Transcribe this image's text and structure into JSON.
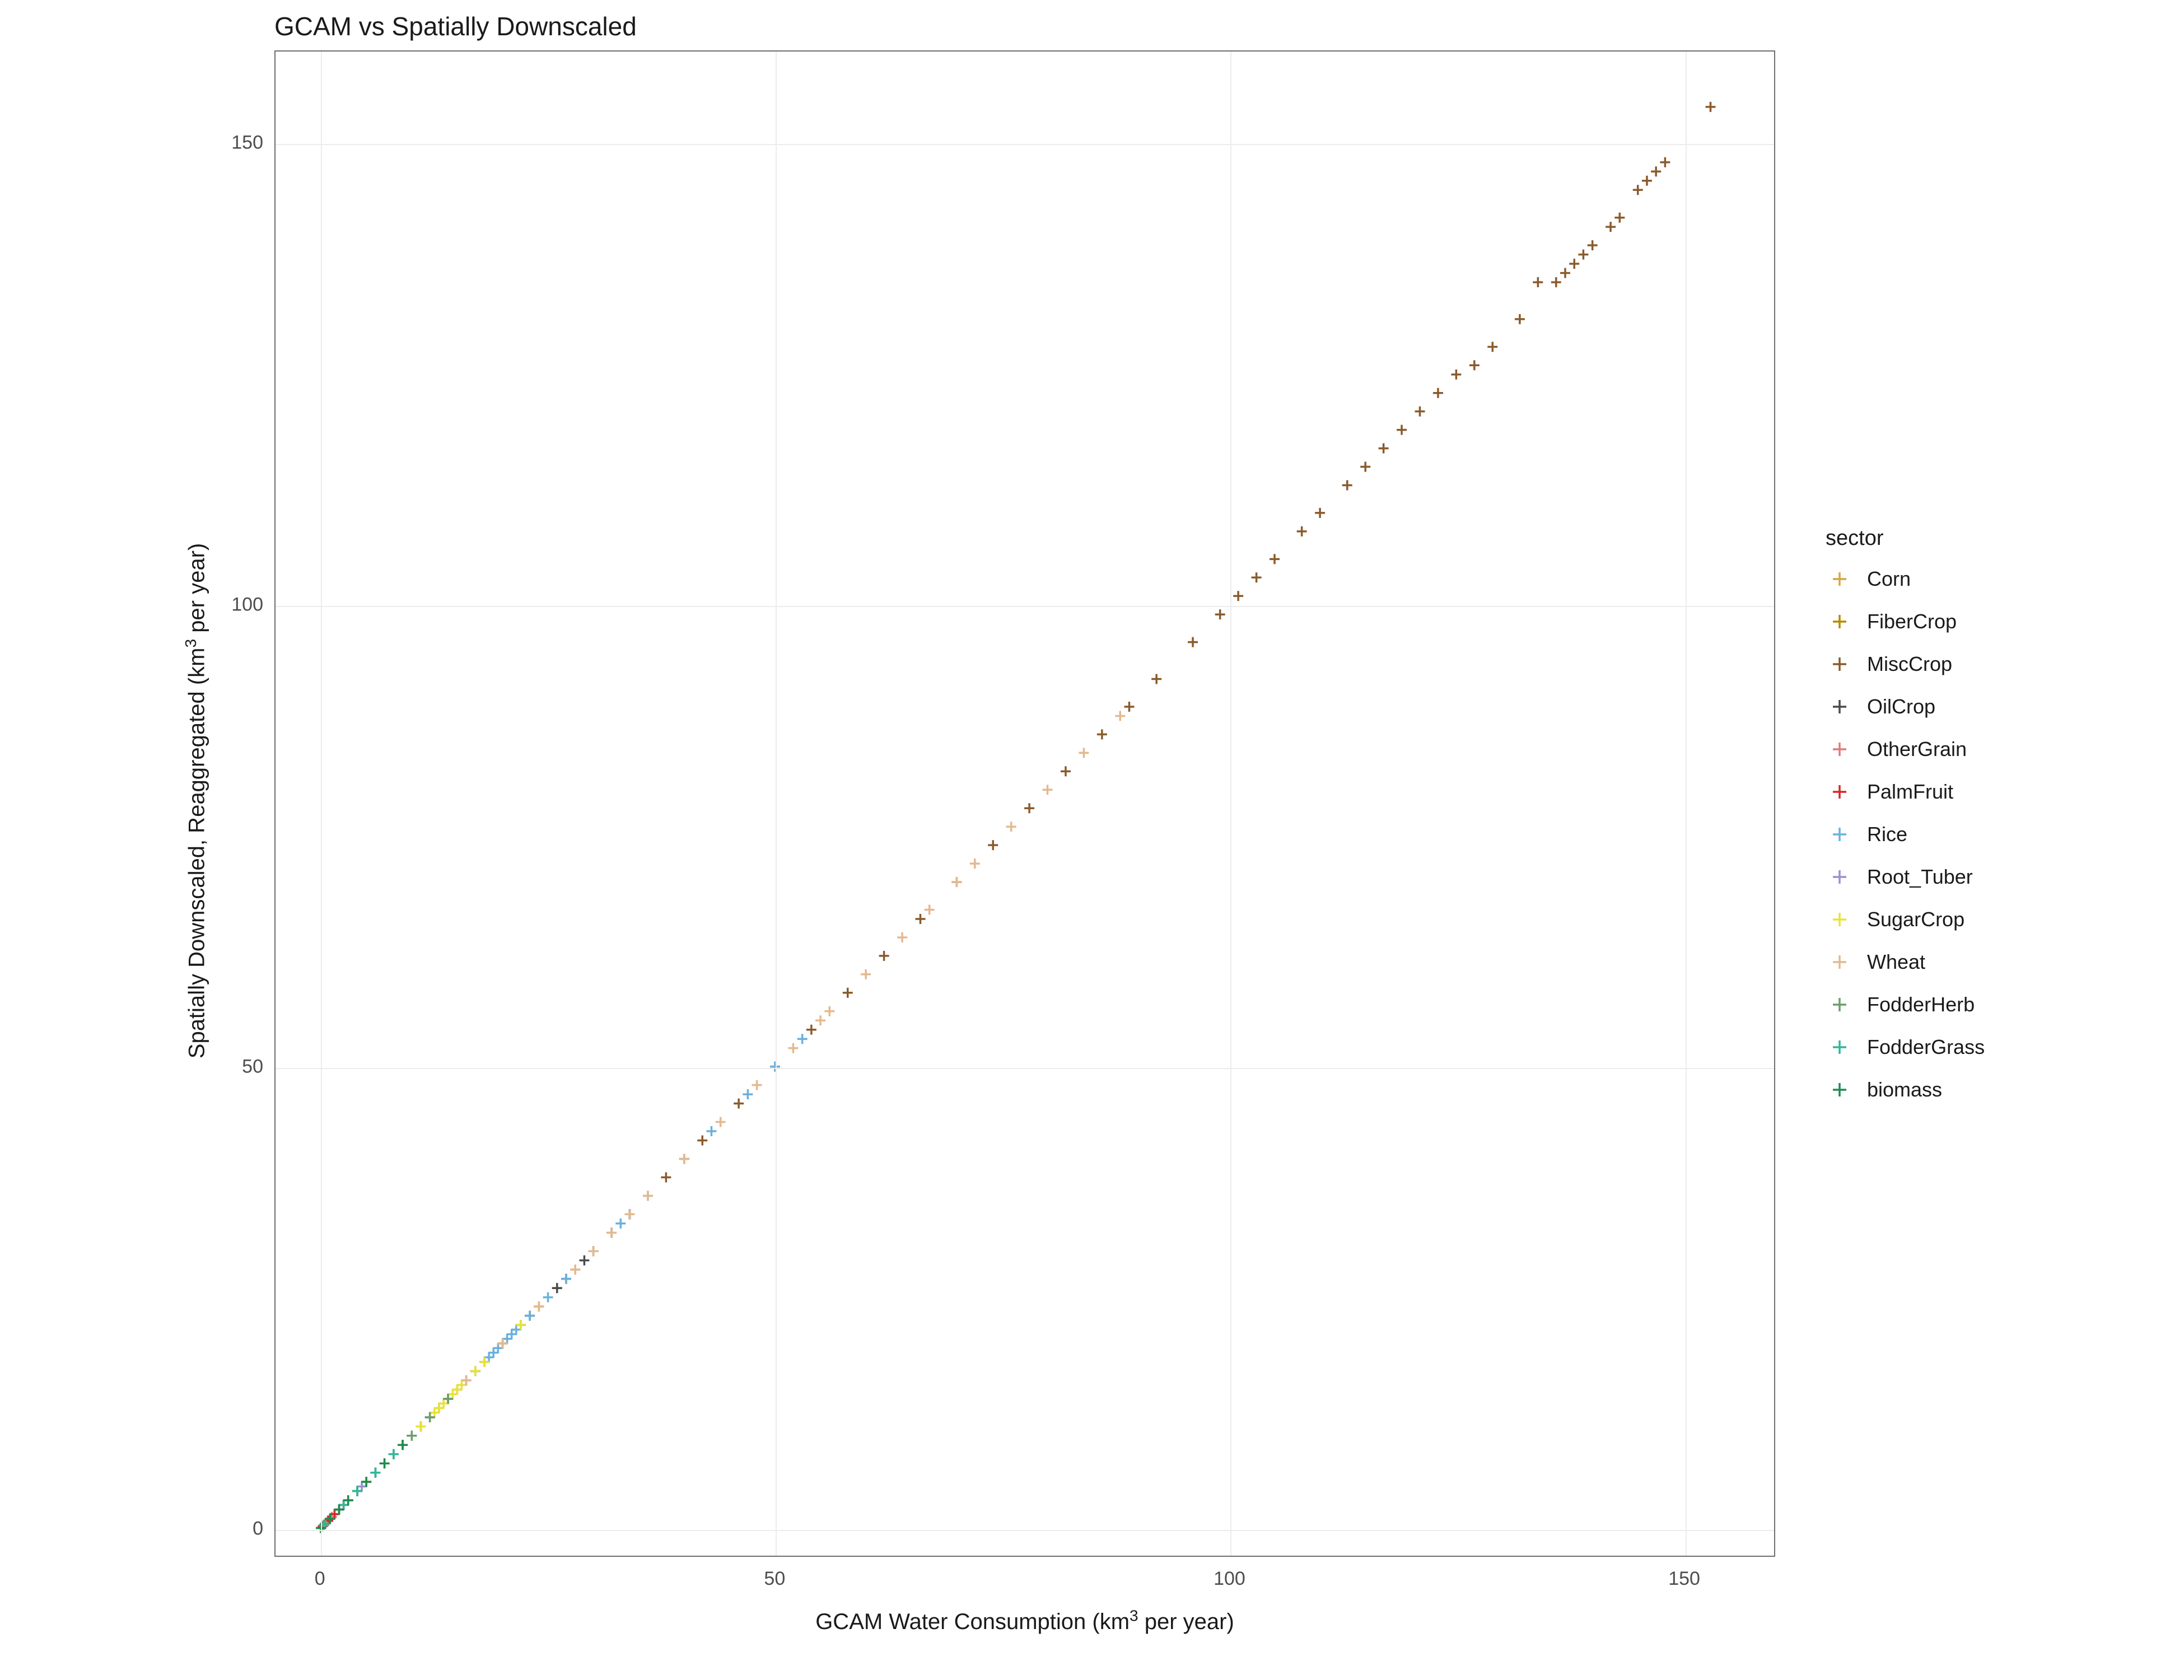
{
  "chart_data": {
    "type": "scatter",
    "title": "GCAM vs Spatially Downscaled",
    "xlabel": "GCAM Water Consumption  (km³ per year)",
    "ylabel": "Spatially Downscaled, Reaggregated  (km³ per year)",
    "legend_title": "sector",
    "xlim": [
      -5,
      160
    ],
    "ylim": [
      -3,
      160
    ],
    "x_ticks": [
      0,
      50,
      100,
      150
    ],
    "y_ticks": [
      0,
      50,
      100,
      150
    ],
    "colors": {
      "Corn": "#d9a441",
      "FiberCrop": "#b58900",
      "MiscCrop": "#8b5a2b",
      "OilCrop": "#4a4a4a",
      "OtherGrain": "#e07a7a",
      "PalmFruit": "#d62728",
      "Rice": "#6ab0de",
      "Root_Tuber": "#9a8ed4",
      "SugarCrop": "#e8e337",
      "Wheat": "#e3b98f",
      "FodderHerb": "#6b9e6b",
      "FodderGrass": "#2fb89a",
      "biomass": "#1d8b4f"
    },
    "legend_order": [
      "Corn",
      "FiberCrop",
      "MiscCrop",
      "OilCrop",
      "OtherGrain",
      "PalmFruit",
      "Rice",
      "Root_Tuber",
      "SugarCrop",
      "Wheat",
      "FodderHerb",
      "FodderGrass",
      "biomass"
    ],
    "series": [
      {
        "name": "Corn",
        "points": [
          [
            0,
            0
          ],
          [
            1.5,
            1.5
          ],
          [
            3,
            3
          ],
          [
            4,
            4
          ],
          [
            6,
            6
          ],
          [
            8,
            8
          ],
          [
            10,
            10
          ],
          [
            12,
            12
          ],
          [
            14,
            14
          ],
          [
            16,
            16
          ],
          [
            18,
            18
          ],
          [
            22,
            22
          ],
          [
            24,
            24
          ],
          [
            26,
            26
          ],
          [
            28,
            28
          ]
        ]
      },
      {
        "name": "FiberCrop",
        "points": [
          [
            0,
            0
          ],
          [
            2,
            2
          ],
          [
            3,
            3
          ],
          [
            5,
            5
          ],
          [
            7,
            7
          ],
          [
            9,
            9
          ],
          [
            11,
            11
          ],
          [
            13,
            13
          ],
          [
            15,
            15
          ]
        ]
      },
      {
        "name": "MiscCrop",
        "points": [
          [
            0,
            0
          ],
          [
            2,
            2
          ],
          [
            5,
            5
          ],
          [
            8,
            8
          ],
          [
            11,
            11
          ],
          [
            14,
            14
          ],
          [
            17,
            17
          ],
          [
            20,
            20
          ],
          [
            24,
            24
          ],
          [
            27,
            27
          ],
          [
            30,
            30
          ],
          [
            34,
            34
          ],
          [
            38,
            38
          ],
          [
            40,
            40
          ],
          [
            42,
            42
          ],
          [
            46,
            46
          ],
          [
            50,
            50
          ],
          [
            54,
            54
          ],
          [
            58,
            58
          ],
          [
            62,
            62
          ],
          [
            66,
            66
          ],
          [
            70,
            70
          ],
          [
            74,
            74
          ],
          [
            78,
            78
          ],
          [
            82,
            82
          ],
          [
            86,
            86
          ],
          [
            89,
            89
          ],
          [
            92,
            92
          ],
          [
            96,
            96
          ],
          [
            99,
            99
          ],
          [
            101,
            101
          ],
          [
            103,
            103
          ],
          [
            105,
            105
          ],
          [
            108,
            108
          ],
          [
            110,
            110
          ],
          [
            113,
            113
          ],
          [
            115,
            115
          ],
          [
            117,
            117
          ],
          [
            119,
            119
          ],
          [
            121,
            121
          ],
          [
            123,
            123
          ],
          [
            125,
            125
          ],
          [
            127,
            126
          ],
          [
            129,
            128
          ],
          [
            132,
            131
          ],
          [
            134,
            135
          ],
          [
            136,
            135
          ],
          [
            137,
            136
          ],
          [
            138,
            137
          ],
          [
            139,
            138
          ],
          [
            140,
            139
          ],
          [
            142,
            141
          ],
          [
            143,
            142
          ],
          [
            145,
            145
          ],
          [
            146,
            146
          ],
          [
            147,
            147
          ],
          [
            148,
            148
          ],
          [
            153,
            154
          ]
        ]
      },
      {
        "name": "OilCrop",
        "points": [
          [
            0,
            0
          ],
          [
            1,
            1
          ],
          [
            4,
            4
          ],
          [
            6,
            6
          ],
          [
            9,
            9
          ],
          [
            12,
            12
          ],
          [
            14,
            14
          ],
          [
            17,
            17
          ],
          [
            20,
            20
          ],
          [
            23,
            23
          ],
          [
            26,
            26
          ],
          [
            29,
            29
          ],
          [
            32,
            32
          ],
          [
            34,
            34
          ]
        ]
      },
      {
        "name": "OtherGrain",
        "points": [
          [
            0.5,
            0.5
          ],
          [
            1.2,
            1.2
          ],
          [
            2.5,
            2.5
          ],
          [
            4,
            4
          ],
          [
            5,
            5
          ],
          [
            7,
            7
          ]
        ]
      },
      {
        "name": "PalmFruit",
        "points": [
          [
            0.2,
            0.2
          ],
          [
            0.8,
            0.8
          ],
          [
            1.5,
            1.5
          ],
          [
            2,
            2
          ],
          [
            2.5,
            2.5
          ]
        ]
      },
      {
        "name": "Rice",
        "points": [
          [
            2,
            2
          ],
          [
            4,
            4
          ],
          [
            6,
            6
          ],
          [
            8,
            8
          ],
          [
            10,
            10
          ],
          [
            12,
            12
          ],
          [
            14,
            14
          ],
          [
            16,
            16
          ],
          [
            17,
            17
          ],
          [
            18,
            18
          ],
          [
            18.5,
            18.5
          ],
          [
            19,
            19
          ],
          [
            19.5,
            19.5
          ],
          [
            20,
            20
          ],
          [
            20.5,
            20.5
          ],
          [
            21,
            21
          ],
          [
            21.5,
            21.5
          ],
          [
            22,
            22
          ],
          [
            23,
            23
          ],
          [
            25,
            25
          ],
          [
            27,
            27
          ],
          [
            30,
            30
          ],
          [
            33,
            33
          ],
          [
            36,
            36
          ],
          [
            40,
            40
          ],
          [
            43,
            43
          ],
          [
            47,
            47
          ],
          [
            50,
            50
          ],
          [
            53,
            53
          ]
        ]
      },
      {
        "name": "Root_Tuber",
        "points": [
          [
            0.3,
            0.3
          ],
          [
            1,
            1
          ],
          [
            2,
            2
          ],
          [
            3,
            3
          ],
          [
            4.5,
            4.5
          ]
        ]
      },
      {
        "name": "SugarCrop",
        "points": [
          [
            1,
            1
          ],
          [
            3,
            3
          ],
          [
            5,
            5
          ],
          [
            7,
            7
          ],
          [
            9,
            9
          ],
          [
            11,
            11
          ],
          [
            12.5,
            12.5
          ],
          [
            13,
            13
          ],
          [
            13.5,
            13.5
          ],
          [
            14,
            14
          ],
          [
            14.5,
            14.5
          ],
          [
            15,
            15
          ],
          [
            15.5,
            15.5
          ],
          [
            16,
            16
          ],
          [
            17,
            17
          ],
          [
            18,
            18
          ],
          [
            20,
            20
          ],
          [
            22,
            22
          ],
          [
            24,
            24
          ]
        ]
      },
      {
        "name": "Wheat",
        "points": [
          [
            1,
            1
          ],
          [
            4,
            4
          ],
          [
            8,
            8
          ],
          [
            12,
            12
          ],
          [
            16,
            16
          ],
          [
            20,
            20
          ],
          [
            24,
            24
          ],
          [
            28,
            28
          ],
          [
            30,
            30
          ],
          [
            32,
            32
          ],
          [
            34,
            34
          ],
          [
            36,
            36
          ],
          [
            40,
            40
          ],
          [
            44,
            44
          ],
          [
            48,
            48
          ],
          [
            52,
            52
          ],
          [
            55,
            55
          ],
          [
            56,
            56
          ],
          [
            60,
            60
          ],
          [
            64,
            64
          ],
          [
            67,
            67
          ],
          [
            70,
            70
          ],
          [
            72,
            72
          ],
          [
            76,
            76
          ],
          [
            80,
            80
          ],
          [
            84,
            84
          ],
          [
            88,
            88
          ]
        ]
      },
      {
        "name": "FodderHerb",
        "points": [
          [
            0.5,
            0.5
          ],
          [
            2,
            2
          ],
          [
            4,
            4
          ],
          [
            6,
            6
          ],
          [
            8,
            8
          ],
          [
            10,
            10
          ],
          [
            12,
            12
          ],
          [
            14,
            14
          ]
        ]
      },
      {
        "name": "FodderGrass",
        "points": [
          [
            0.3,
            0.3
          ],
          [
            1,
            1
          ],
          [
            2.5,
            2.5
          ],
          [
            4,
            4
          ],
          [
            6,
            6
          ],
          [
            8,
            8
          ]
        ]
      },
      {
        "name": "biomass",
        "points": [
          [
            0,
            0
          ],
          [
            1,
            1
          ],
          [
            2,
            2
          ],
          [
            3,
            3
          ],
          [
            5,
            5
          ],
          [
            7,
            7
          ],
          [
            9,
            9
          ]
        ]
      }
    ]
  }
}
